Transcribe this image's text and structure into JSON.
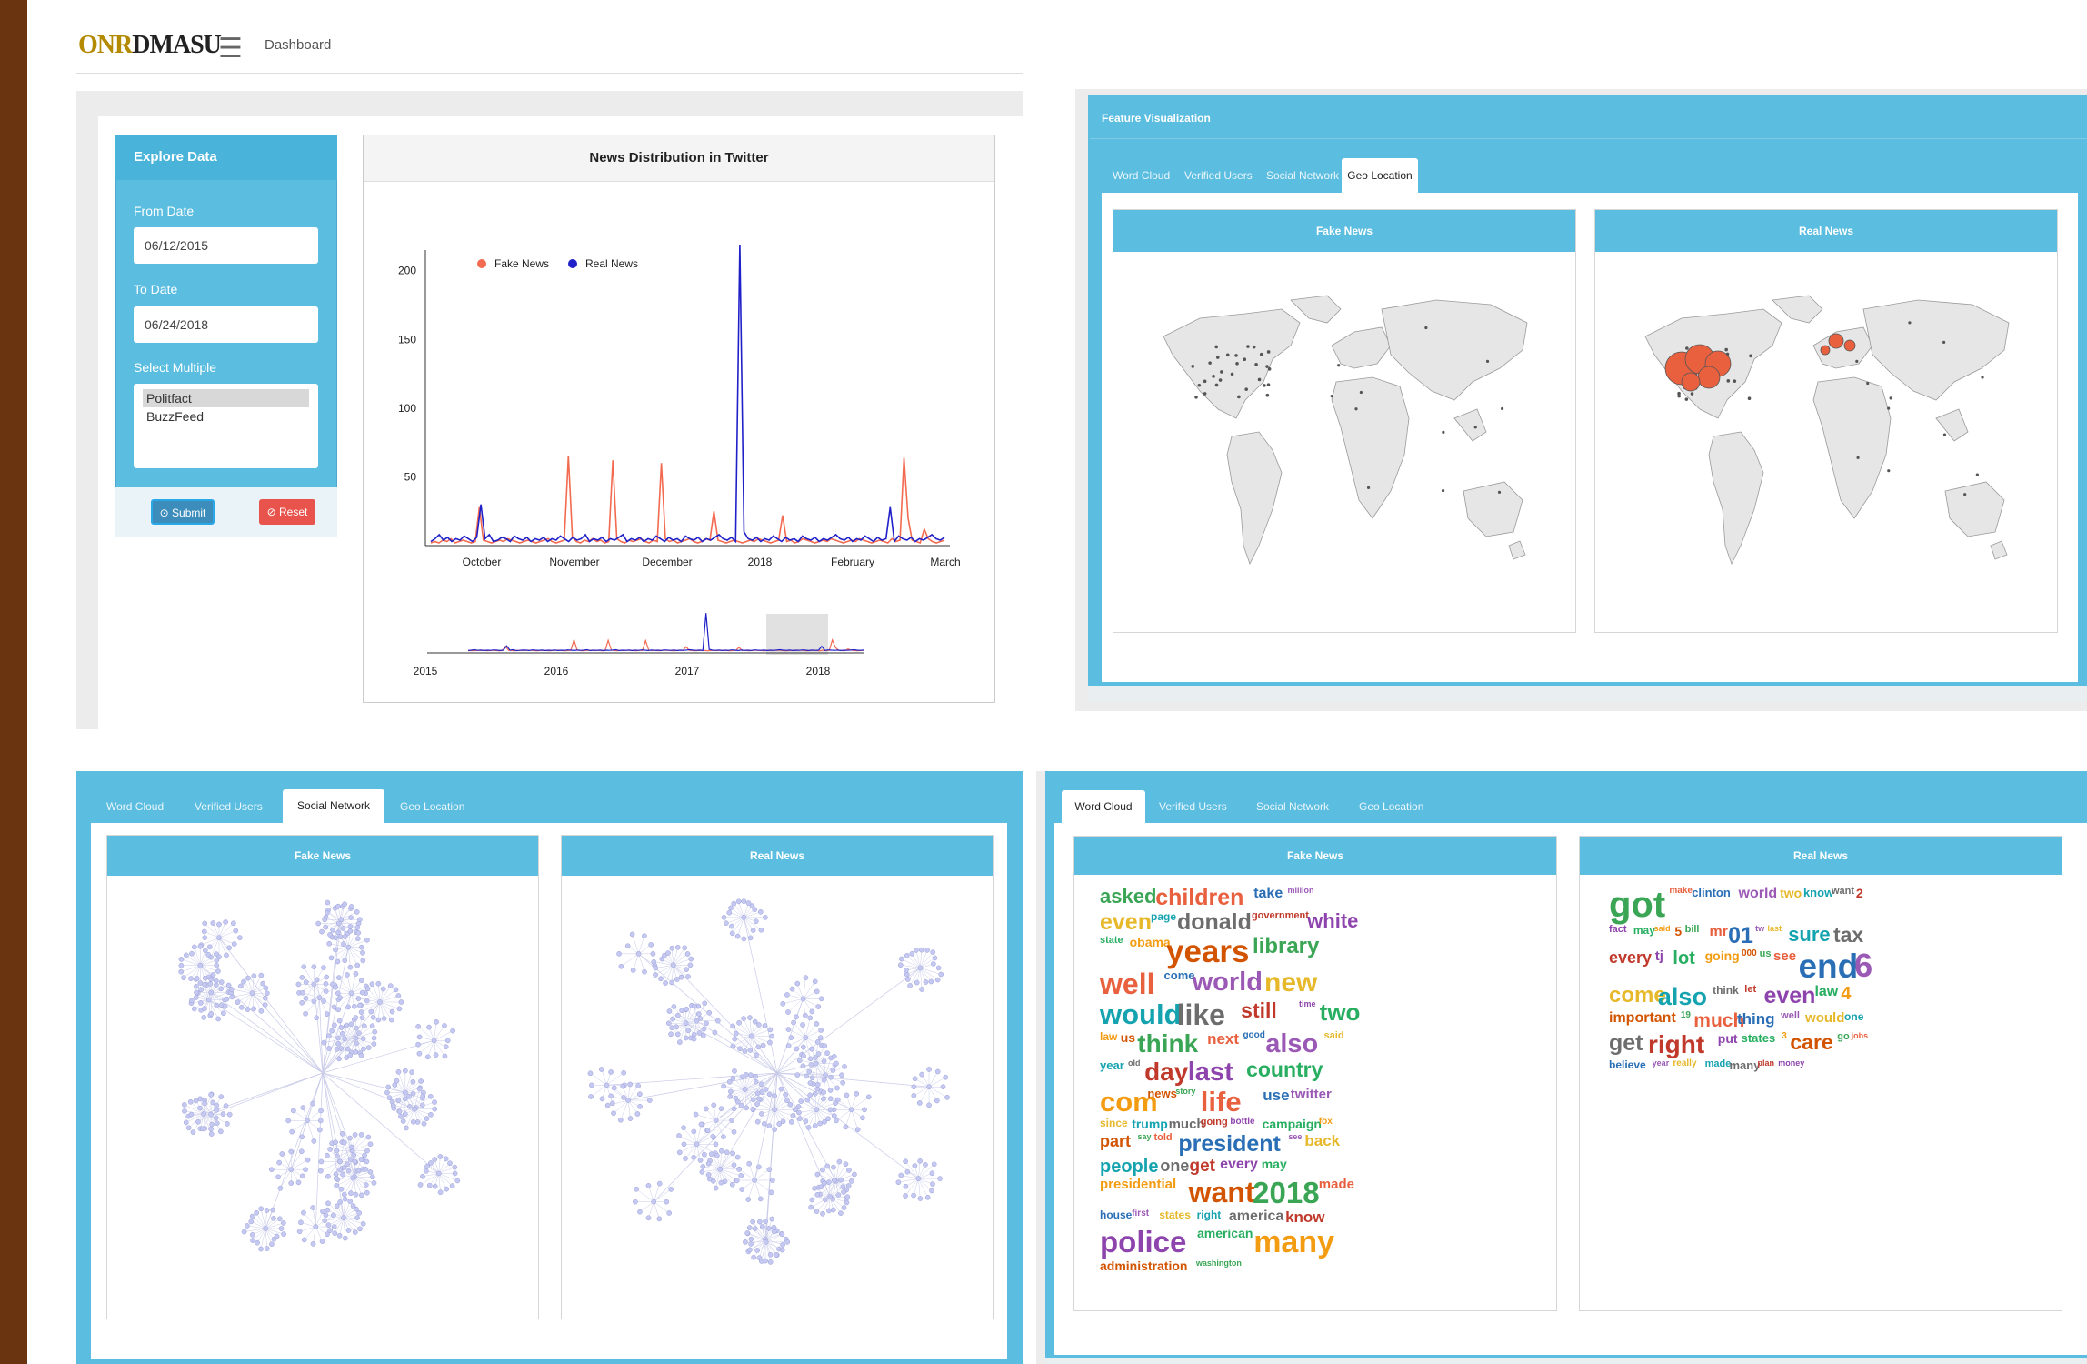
{
  "header": {
    "logo_text": "ONR",
    "logo_accent": "DMASU",
    "breadcrumb": "Dashboard"
  },
  "explore": {
    "title": "Explore Data",
    "from_label": "From Date",
    "from_value": "06/12/2015",
    "to_label": "To Date",
    "to_value": "06/24/2018",
    "select_label": "Select Multiple",
    "options": [
      "Politfact",
      "BuzzFeed"
    ],
    "selected_option": "Politfact",
    "submit_label": "Submit",
    "reset_label": "Reset"
  },
  "chart_panel": {
    "title": "News Distribution in Twitter"
  },
  "chart_data": {
    "type": "line",
    "title": "News Distribution in Twitter",
    "x_ticks": [
      "October",
      "November",
      "December",
      "2018",
      "February",
      "March"
    ],
    "y_ticks": [
      50,
      100,
      150,
      200
    ],
    "ylim": [
      0,
      215
    ],
    "legend_position": "top-left",
    "colors": {
      "fake": "#f26a4f",
      "real": "#2020c8"
    },
    "series": [
      {
        "name": "Fake News",
        "values": [
          2,
          3,
          2,
          4,
          3,
          5,
          2,
          3,
          4,
          3,
          2,
          3,
          28,
          4,
          3,
          2,
          3,
          4,
          3,
          5,
          4,
          3,
          2,
          3,
          4,
          3,
          2,
          3,
          4,
          5,
          3,
          2,
          3,
          4,
          65,
          6,
          3,
          2,
          4,
          3,
          5,
          3,
          4,
          2,
          3,
          62,
          5,
          3,
          2,
          4,
          3,
          4,
          5,
          3,
          2,
          4,
          3,
          60,
          5,
          3,
          4,
          2,
          3,
          4,
          5,
          3,
          2,
          3,
          5,
          4,
          25,
          4,
          3,
          2,
          3,
          4,
          3,
          2,
          3,
          4,
          3,
          5,
          4,
          3,
          2,
          3,
          4,
          22,
          3,
          4,
          2,
          3,
          5,
          4,
          3,
          2,
          3,
          4,
          3,
          5,
          4,
          3,
          2,
          3,
          4,
          3,
          5,
          4,
          3,
          2,
          3,
          4,
          3,
          2,
          5,
          3,
          4,
          64,
          20,
          4,
          3,
          2,
          12,
          5,
          3,
          2,
          3,
          4
        ]
      },
      {
        "name": "Real News",
        "values": [
          3,
          5,
          8,
          4,
          6,
          3,
          5,
          4,
          7,
          5,
          3,
          6,
          30,
          5,
          8,
          3,
          4,
          6,
          5,
          3,
          7,
          5,
          4,
          6,
          3,
          5,
          4,
          6,
          3,
          5,
          4,
          7,
          5,
          3,
          6,
          4,
          5,
          8,
          3,
          5,
          4,
          6,
          3,
          5,
          4,
          6,
          8,
          3,
          5,
          4,
          6,
          3,
          5,
          4,
          7,
          5,
          3,
          6,
          4,
          5,
          3,
          7,
          5,
          4,
          6,
          3,
          5,
          4,
          6,
          8,
          5,
          4,
          6,
          3,
          219,
          10,
          5,
          4,
          6,
          3,
          5,
          4,
          7,
          5,
          3,
          6,
          4,
          5,
          3,
          7,
          5,
          4,
          6,
          3,
          5,
          4,
          6,
          8,
          5,
          4,
          6,
          3,
          5,
          4,
          7,
          5,
          3,
          6,
          4,
          5,
          28,
          3,
          7,
          5,
          4,
          6,
          3,
          5,
          4,
          6,
          8,
          5,
          4,
          6
        ]
      }
    ],
    "navigator_ticks": [
      "2015",
      "2016",
      "2017",
      "2018"
    ]
  },
  "feature_viz": {
    "title": "Feature Visualization",
    "tabs": [
      "Word Cloud",
      "Verified Users",
      "Social Network",
      "Geo Location"
    ],
    "active_tab": "Geo Location",
    "fake_label": "Fake News",
    "real_label": "Real News"
  },
  "social_panel": {
    "tabs": [
      "Word Cloud",
      "Verified Users",
      "Social Network",
      "Geo Location"
    ],
    "active_tab": "Social Network",
    "fake_label": "Fake News",
    "real_label": "Real News"
  },
  "word_panel": {
    "tabs": [
      "Word Cloud",
      "Verified Users",
      "Social Network",
      "Geo Location"
    ],
    "active_tab": "Word Cloud",
    "fake_label": "Fake News",
    "real_label": "Real News",
    "fake_words": [
      "asked",
      "children",
      "take",
      "million",
      "even",
      "page",
      "donald",
      "government",
      "white",
      "state",
      "obama",
      "years",
      "library",
      "well",
      "come",
      "world",
      "new",
      "would",
      "like",
      "still",
      "time",
      "two",
      "law",
      "us",
      "think",
      "next",
      "good",
      "also",
      "said",
      "year",
      "old",
      "day",
      "last",
      "country",
      "com",
      "news",
      "story",
      "life",
      "use",
      "twitter",
      "since",
      "trump",
      "much",
      "going",
      "bottle",
      "campaign",
      "fox",
      "part",
      "say",
      "told",
      "president",
      "see",
      "back",
      "people",
      "one",
      "get",
      "every",
      "may",
      "presidential",
      "want",
      "2018",
      "made",
      "house",
      "first",
      "states",
      "right",
      "america",
      "know",
      "police",
      "american",
      "many",
      "administration",
      "washington"
    ],
    "real_words": [
      "got",
      "make",
      "clinton",
      "world",
      "two",
      "know",
      "want",
      "2",
      "fact",
      "may",
      "said",
      "5",
      "bill",
      "mr",
      "01",
      "tw",
      "last",
      "sure",
      "tax",
      "every",
      "tj",
      "lot",
      "going",
      "000",
      "us",
      "see",
      "end",
      "6",
      "come",
      "also",
      "think",
      "let",
      "even",
      "law",
      "4",
      "important",
      "19",
      "much",
      "thing",
      "well",
      "would",
      "one",
      "get",
      "right",
      "put",
      "states",
      "3",
      "care",
      "go",
      "jobs",
      "believe",
      "year",
      "really",
      "made",
      "many",
      "plan",
      "money"
    ]
  }
}
